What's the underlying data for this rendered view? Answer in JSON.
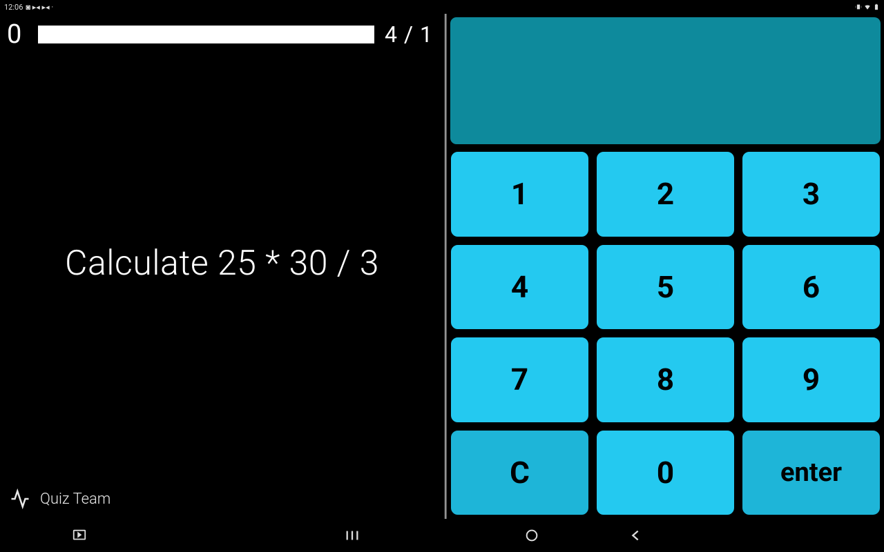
{
  "status": {
    "time": "12:06",
    "indicators": "◙ ▸◂ ▸◂ ·"
  },
  "left": {
    "score": "0",
    "counter": "4 / 1",
    "question": "Calculate 25 * 30 / 3",
    "team_label": "Quiz Team"
  },
  "keypad": {
    "display": "",
    "keys": {
      "k1": "1",
      "k2": "2",
      "k3": "3",
      "k4": "4",
      "k5": "5",
      "k6": "6",
      "k7": "7",
      "k8": "8",
      "k9": "9",
      "clear": "C",
      "k0": "0",
      "enter": "enter"
    }
  },
  "colors": {
    "key_bg": "#24c9f0",
    "key_func_bg": "#1eb5d8",
    "display_bg": "#0e8a9c"
  }
}
